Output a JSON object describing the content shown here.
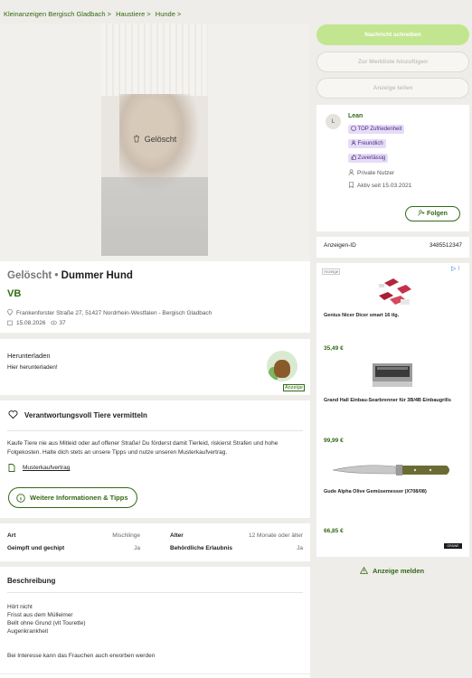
{
  "breadcrumb": [
    "Kleinanzeigen Bergisch Gladbach >",
    "Haustiere >",
    "Hunde >"
  ],
  "gallery": {
    "overlay_label": "Gelöscht"
  },
  "ad": {
    "status": "Gelöscht •",
    "title": "Dummer Hund",
    "price": "VB",
    "address": "Frankenforster Straße 27, 51427 Nordrhein-Westfalen - Bergisch Gladbach",
    "date": "15.08.2026",
    "views": "37"
  },
  "download": {
    "title": "Herunterladen",
    "subtitle": "Hier herunterladen!",
    "badge_label": "Anzeige"
  },
  "responsibility": {
    "title": "Verantwortungsvoll Tiere vermitteln",
    "text": "Kaufe Tiere nie aus Mitleid oder auf offener Straße! Du förderst damit Tierleid, riskierst Strafen und hohe Folgekosten. Halte dich stets an unsere Tipps und nutze unseren Musterkaufvertrag.",
    "contract_link": "Musterkaufvertrag",
    "more_button": "Weitere Informationen & Tipps"
  },
  "attributes": [
    {
      "key": "Art",
      "value": "Mischlinge"
    },
    {
      "key": "Alter",
      "value": "12 Monate oder älter"
    },
    {
      "key": "Geimpft und gechipt",
      "value": "Ja"
    },
    {
      "key": "Behördliche Erlaubnis",
      "value": "Ja"
    }
  ],
  "description": {
    "title": "Beschreibung",
    "lines": [
      "Hört nicht",
      "Frisst aus dem Mülleimer",
      "Bellt ohne Grund (vlt Tourette)",
      "Augenkrankheit"
    ],
    "extra": "Bei Interesse kann das Frauchen auch erworben werden"
  },
  "actions": {
    "message": "Nachricht schreiben",
    "watchlist": "Zur Merkliste hinzufügen",
    "share": "Anzeige teilen"
  },
  "seller": {
    "initial": "L",
    "name": "Lean",
    "badges": [
      "TOP Zufriedenheit",
      "Freundlich",
      "Zuverlässig"
    ],
    "type": "Private Nutzer",
    "active_since": "Aktiv seit 15.03.2021",
    "follow": "Folgen"
  },
  "ad_id": {
    "label": "Anzeigen-ID",
    "value": "3485512347"
  },
  "sponsored": {
    "tag": "Anzeige",
    "brand": "GRÄWE",
    "products": [
      {
        "name": "Genius Nicer Dicer smart 16 tlg.",
        "price": "35,49 €"
      },
      {
        "name": "Grand Hall Einbau-Searbrenner für 3B/4B Einbaugrills",
        "price": "99,99 €"
      },
      {
        "name": "Gude Alpha Olive Gemüsemesser (X708/08)",
        "price": "66,85 €"
      }
    ]
  },
  "report": "Anzeige melden",
  "colors": {
    "brand_green": "#326916",
    "button_green": "#c2e68f",
    "background": "#efede9",
    "tag_purple": "#e6dcf5"
  }
}
